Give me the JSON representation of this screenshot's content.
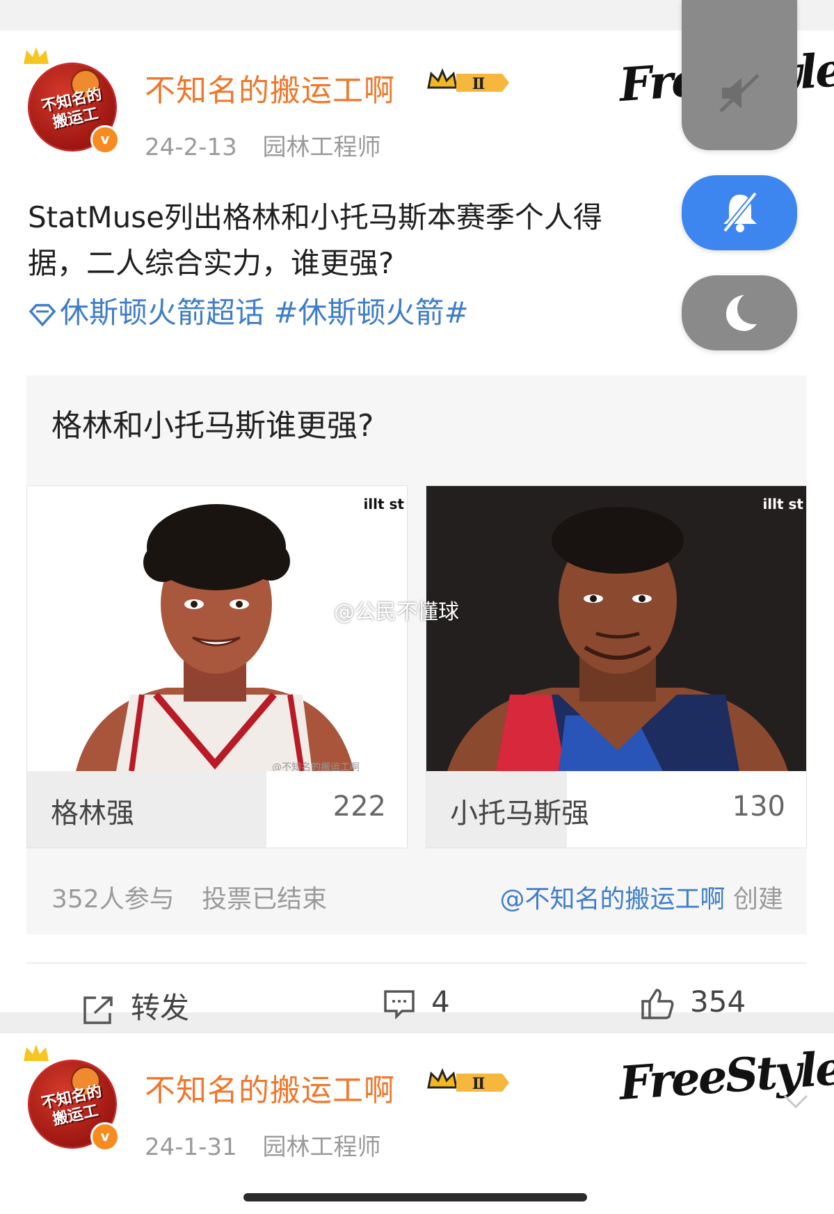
{
  "post1": {
    "username": "不知名的搬运工啊",
    "avatar_text": "不知名的搬运工",
    "level_badge": "Ⅱ",
    "date": "24-2-13",
    "source": "园林工程师",
    "freestyle_logo": "FreeStyle",
    "text": "StatMuse列出格林和小托马斯本赛季个人得分数据，二人综合实力，谁更强?",
    "text_line1": "StatMuse列出格林和小托马斯本赛季个人得",
    "text_line2": "据，二人综合实力，谁更强?",
    "tags": "休斯顿火箭超话 #休斯顿火箭#",
    "poll": {
      "question": "格林和小托马斯谁更强?",
      "options": [
        {
          "label": "格林强",
          "count": "222",
          "share": 0.63,
          "image_watermark": "@不知名的搬运工啊"
        },
        {
          "label": "小托马斯强",
          "count": "130",
          "share": 0.37
        }
      ],
      "participants": "352人参与",
      "status": "投票已结束",
      "creator_link": "@不知名的搬运工啊",
      "creator_suffix": "创建"
    },
    "actions": {
      "repost_label": "转发",
      "comment_count": "4",
      "like_count": "354"
    }
  },
  "post2": {
    "username": "不知名的搬运工啊",
    "avatar_text": "不知名的搬运工",
    "level_badge": "Ⅱ",
    "date": "24-1-31",
    "source": "园林工程师",
    "freestyle_logo": "FreeStyle"
  },
  "overlay_watermark": "@公民不懂球",
  "statmuse_mark": "illt st",
  "colors": {
    "username": "#f0762a",
    "link": "#3f7dc8",
    "bell_button": "#3d86ef",
    "grey_button": "#8a8a8a"
  },
  "icons": [
    "crown-icon",
    "verified-icon",
    "vip-crown-icon",
    "diamond-icon",
    "chevron-down-icon",
    "repost-icon",
    "comment-icon",
    "like-icon",
    "mute-icon",
    "bell-off-icon",
    "moon-icon"
  ]
}
